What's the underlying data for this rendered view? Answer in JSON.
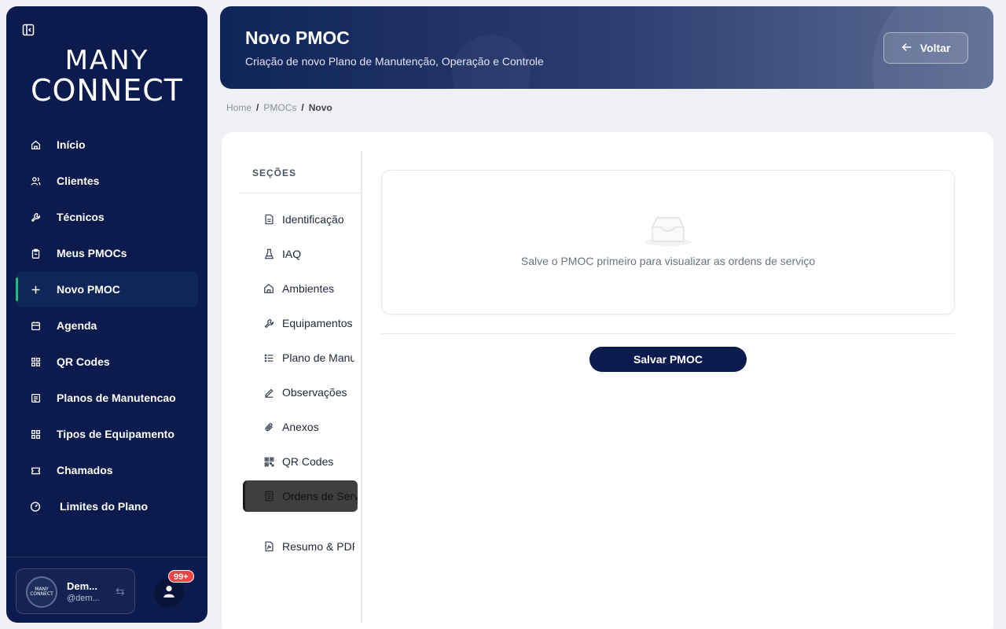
{
  "sidebar": {
    "logo_line1": "MANY",
    "logo_line2": "CONNECT",
    "items": [
      {
        "label": "Início",
        "icon": "home-icon"
      },
      {
        "label": "Clientes",
        "icon": "users-icon"
      },
      {
        "label": "Técnicos",
        "icon": "wrench-icon"
      },
      {
        "label": "Meus PMOCs",
        "icon": "clipboard-icon"
      },
      {
        "label": "Novo PMOC",
        "icon": "plus-icon"
      },
      {
        "label": "Agenda",
        "icon": "calendar-icon"
      },
      {
        "label": "QR Codes",
        "icon": "grid-icon"
      },
      {
        "label": "Planos de Manutencao",
        "icon": "list-icon"
      },
      {
        "label": "Tipos de Equipamento",
        "icon": "grid-icon"
      },
      {
        "label": "Chamados",
        "icon": "ticket-icon"
      },
      {
        "label": "Limites do Plano",
        "icon": "gauge-icon"
      }
    ],
    "user": {
      "name": "Dem...",
      "handle": "@dem...",
      "avatar_line1": "MANY",
      "avatar_line2": "CONNECT"
    },
    "notification_count": "99+"
  },
  "header": {
    "title": "Novo PMOC",
    "subtitle": "Criação de novo Plano de Manutenção, Operação e Controle",
    "back_label": "Voltar"
  },
  "breadcrumb": {
    "items": [
      "Home",
      "PMOCs",
      "Novo"
    ]
  },
  "sections": {
    "title": "SEÇÕES",
    "items": [
      {
        "label": "Identificação",
        "icon": "document-icon"
      },
      {
        "label": "IAQ",
        "icon": "flask-icon"
      },
      {
        "label": "Ambientes",
        "icon": "home-icon"
      },
      {
        "label": "Equipamentos",
        "icon": "wrench-icon"
      },
      {
        "label": "Plano de Manutenção",
        "icon": "list-icon"
      },
      {
        "label": "Observações",
        "icon": "pen-icon"
      },
      {
        "label": "Anexos",
        "icon": "paperclip-icon"
      },
      {
        "label": "QR Codes",
        "icon": "qrcode-icon"
      },
      {
        "label": "Ordens de Serviço",
        "icon": "receipt-icon"
      },
      {
        "label": "Resumo & PDF",
        "icon": "pdf-icon"
      }
    ]
  },
  "main": {
    "empty_message": "Salve o PMOC primeiro para visualizar as ordens de serviço",
    "save_label": "Salvar PMOC"
  },
  "colors": {
    "sidebar_bg": "#0b1b4d",
    "accent_green": "#1fbf7a",
    "badge_red": "#ef4444",
    "primary_button": "#0b1b4d"
  }
}
